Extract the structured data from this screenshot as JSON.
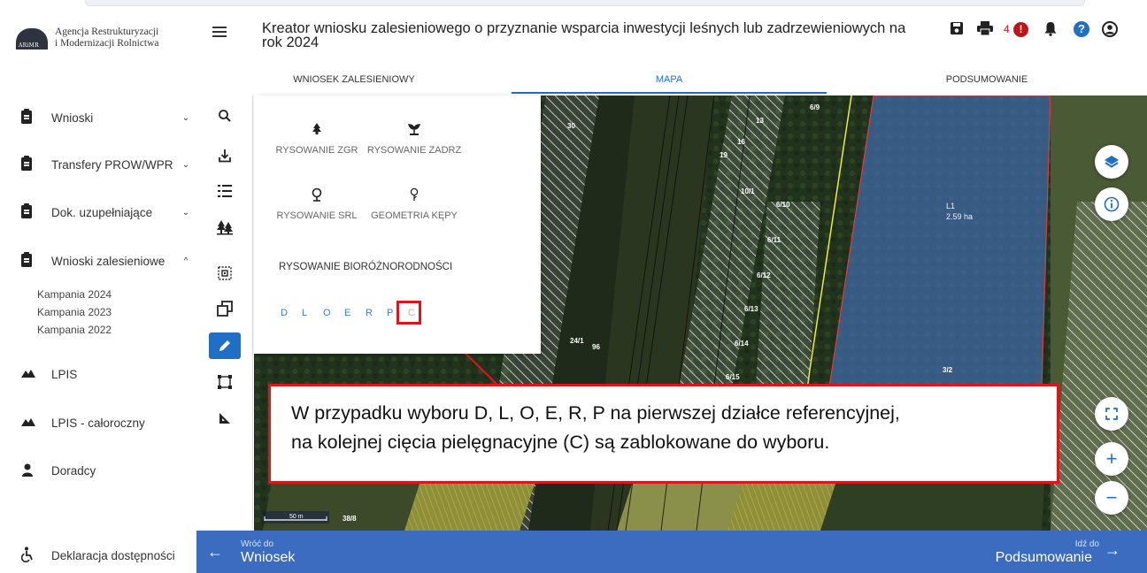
{
  "logo": {
    "text_line1": "Agencja Restrukturyzacji",
    "text_line2": "i Modernizacji Rolnictwa",
    "mark_text": "ARiMR"
  },
  "sidebar": {
    "items": [
      {
        "label": "Wnioski",
        "chevron": "⌄"
      },
      {
        "label": "Transfery PROW/WPR",
        "chevron": "⌄"
      },
      {
        "label": "Dok. uzupełniające",
        "chevron": "⌄"
      },
      {
        "label": "Wnioski zalesieniowe",
        "chevron": "^"
      }
    ],
    "campaigns": [
      "Kampania 2024",
      "Kampania 2023",
      "Kampania 2022"
    ],
    "links": [
      {
        "label": "LPIS",
        "icon": "mountain-icon"
      },
      {
        "label": "LPIS - całoroczny",
        "icon": "mountain-icon"
      },
      {
        "label": "Doradcy",
        "icon": "person-icon"
      }
    ],
    "accessibility": "Deklaracja dostępności"
  },
  "header": {
    "title": "Kreator wniosku zalesieniowego o przyznanie wsparcia inwestycji leśnych lub zadrzewieniowych na rok 2024",
    "notification_count": "4",
    "error_badge": "!"
  },
  "tabs": [
    "WNIOSEK ZALESIENIOWY",
    "MAPA",
    "PODSUMOWANIE"
  ],
  "active_tab": "MAPA",
  "panel": {
    "buttons": [
      "RYSOWANIE ZGR",
      "RYSOWANIE ZADRZ",
      "RYSOWANIE SRL",
      "GEOMETRIA KĘPY"
    ],
    "bio_title": "RYSOWANIE BIORÓŻNORODNOŚCI",
    "letters": [
      "D",
      "L",
      "O",
      "E",
      "R",
      "P",
      "C"
    ],
    "disabled_letter": "C"
  },
  "map": {
    "parcels": [
      "30",
      "13",
      "16",
      "19",
      "6/9",
      "10/1",
      "6/10",
      "6/11",
      "6/12",
      "6/13",
      "6/14",
      "6/15",
      "24/1",
      "96",
      "3/2",
      "38/8"
    ],
    "area_label": "L1",
    "area_value": "2.59 ha",
    "scale": "50 m"
  },
  "callout": {
    "text_line1": "W przypadku wyboru D, L, O, E, R, P na pierwszej działce referencyjnej,",
    "text_line2": "na kolejnej cięcia pielęgnacyjne (C) są zablokowane do wyboru."
  },
  "footer": {
    "back_small": "Wróć do",
    "back_big": "Wniosek",
    "next_small": "Idź do",
    "next_big": "Podsumowanie"
  },
  "colors": {
    "accent": "#1e6fc5",
    "footer": "#3b6cc0",
    "highlight": "#e1141c",
    "error": "#c0141a"
  }
}
